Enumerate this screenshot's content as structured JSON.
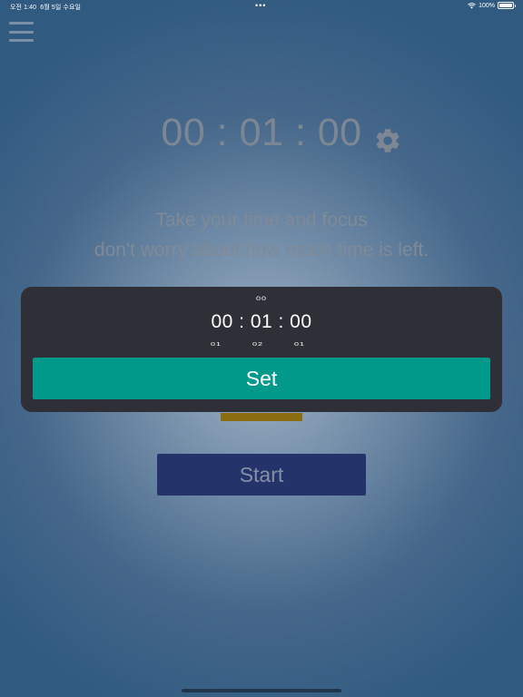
{
  "status_bar": {
    "time": "오전 1:40",
    "date": "6월 5일 수요일",
    "dots": "•••",
    "battery_text": "100%"
  },
  "timer": {
    "display": "00 : 01 : 00"
  },
  "message": {
    "line1": "Take your time and focus",
    "line2": "don't worry about how much time is left."
  },
  "picker": {
    "top_value": "00",
    "selected": "00 : 01 : 00",
    "below_hours": "01",
    "below_minutes": "02",
    "below_seconds": "01",
    "set_label": "Set"
  },
  "start_label": "Start",
  "colors": {
    "set_button": "#00998a",
    "start_button": "#24336a",
    "progress": "#8a6d10",
    "panel": "#2f2f37"
  },
  "icons": {
    "menu": "hamburger-menu-icon",
    "settings": "gear-icon",
    "wifi": "wifi-icon",
    "battery": "battery-icon"
  }
}
